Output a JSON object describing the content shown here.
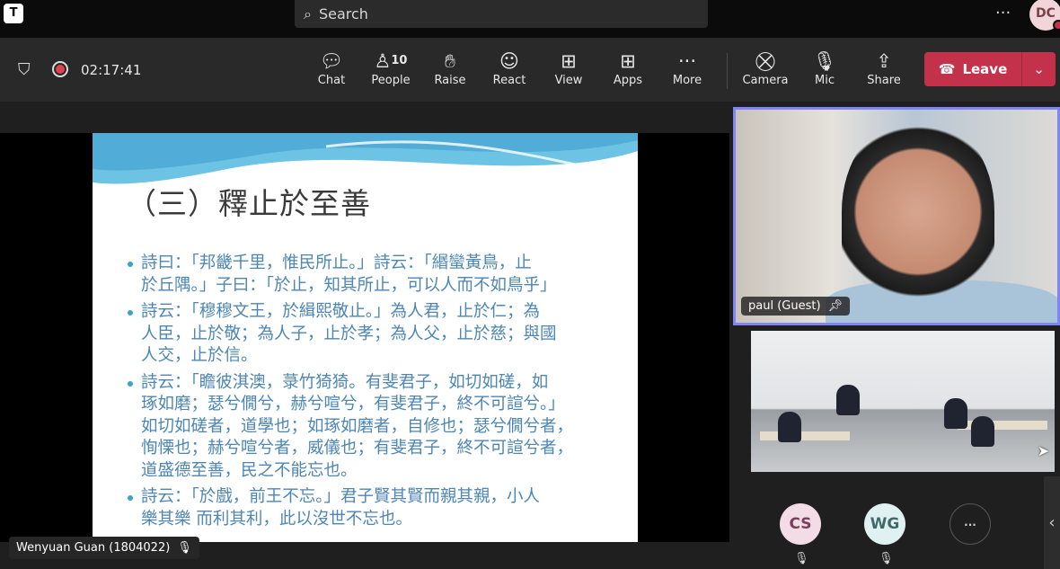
{
  "topbar": {
    "search_placeholder": "Search",
    "avatar_initials": "DC",
    "more": "···"
  },
  "toolbar": {
    "timer": "02:17:41",
    "buttons": [
      {
        "label": "Chat",
        "icon": "chat-icon"
      },
      {
        "label": "People",
        "icon": "people-icon",
        "count": "10"
      },
      {
        "label": "Raise",
        "icon": "hand-icon"
      },
      {
        "label": "React",
        "icon": "smile-icon"
      },
      {
        "label": "View",
        "icon": "grid-icon"
      },
      {
        "label": "Apps",
        "icon": "plus-square-icon"
      },
      {
        "label": "More",
        "icon": "ellipsis-icon"
      },
      {
        "label": "Camera",
        "icon": "camera-off-icon"
      },
      {
        "label": "Mic",
        "icon": "mic-off-icon"
      },
      {
        "label": "Share",
        "icon": "share-icon"
      }
    ],
    "leave_label": "Leave"
  },
  "slide": {
    "title": "（三）釋止於至善",
    "bullets": [
      [
        "詩曰：「邦畿千里，惟民所止。」詩云：「緡蠻黃鳥，止",
        "於丘隅。」子曰：「於止，知其所止，可以人而不如鳥乎」"
      ],
      [
        "詩云：「穆穆文王，於緝熙敬止。」為人君，止於仁；為",
        "人臣，止於敬；為人子，止於孝；為人父，止於慈；與國",
        "人交，止於信。"
      ],
      [
        "詩云：「瞻彼淇澳，菉竹猗猗。有斐君子，如切如磋，如",
        "琢如磨；瑟兮僩兮，赫兮喧兮，有斐君子，終不可諠兮。」",
        "如切如磋者，道學也；如琢如磨者，自修也；瑟兮僩兮者，",
        "恂慄也；赫兮喧兮者，威儀也；有斐君子，終不可諠兮者，",
        "道盛德至善，民之不能忘也。"
      ],
      [
        "詩云：「於戲，前王不忘。」君子賢其賢而親其親，小人",
        "樂其樂 而利其利，此以沒世不忘也。"
      ]
    ]
  },
  "presenter_label": "Wenyuan Guan (1804022)",
  "participants": {
    "pinned_name": "paul (Guest)",
    "avatars": [
      {
        "initials": "CS",
        "bg": "#f3dce6",
        "fg": "#7a3f5a"
      },
      {
        "initials": "WG",
        "bg": "#dff1f1",
        "fg": "#3f6b6b"
      },
      {
        "initials": "···",
        "bg": "#1f1f1f",
        "fg": "#ccc"
      }
    ]
  },
  "colors": {
    "leave": "#c4314b",
    "pinned_border": "#7f85f5",
    "slide_text": "#4d86b4"
  }
}
